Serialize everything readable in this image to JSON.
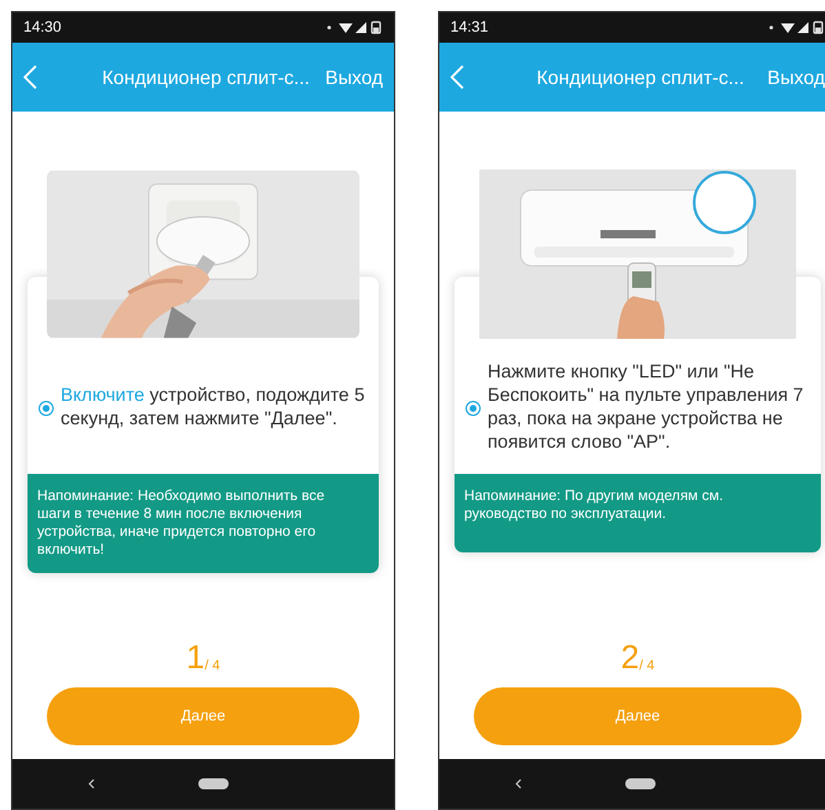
{
  "screens": [
    {
      "status_bar": {
        "time": "14:30"
      },
      "app_bar": {
        "title": "Кондиционер сплит-с...",
        "action": "Выход"
      },
      "picture": {
        "kind": "plug"
      },
      "instruction": {
        "checked": true,
        "parts": [
          {
            "text": "Включите",
            "link": true
          },
          {
            "text": " устройство, подождите 5 секунд, затем нажмите \"Далее\".",
            "link": false
          }
        ]
      },
      "note": "Напоминание: Необходимо выполнить все шаги в течение 8 мин после включения устройства, иначе придется повторно его включить!",
      "step": {
        "current": "1",
        "total": "/ 4"
      },
      "button": "Далее"
    },
    {
      "status_bar": {
        "time": "14:31"
      },
      "app_bar": {
        "title": "Кондиционер сплит-с...",
        "action": "Выход"
      },
      "picture": {
        "kind": "aircon"
      },
      "instruction": {
        "checked": true,
        "parts": [
          {
            "text": "Нажмите кнопку \"LED\" или \"Не Беспокоить\" на пульте управления 7 раз, пока на экране устройства не появится слово \"AP\".",
            "link": false
          }
        ]
      },
      "note": "Напоминание: По другим моделям см. руководство по эксплуатации.",
      "step": {
        "current": "2",
        "total": "/ 4"
      },
      "button": "Далее"
    }
  ]
}
